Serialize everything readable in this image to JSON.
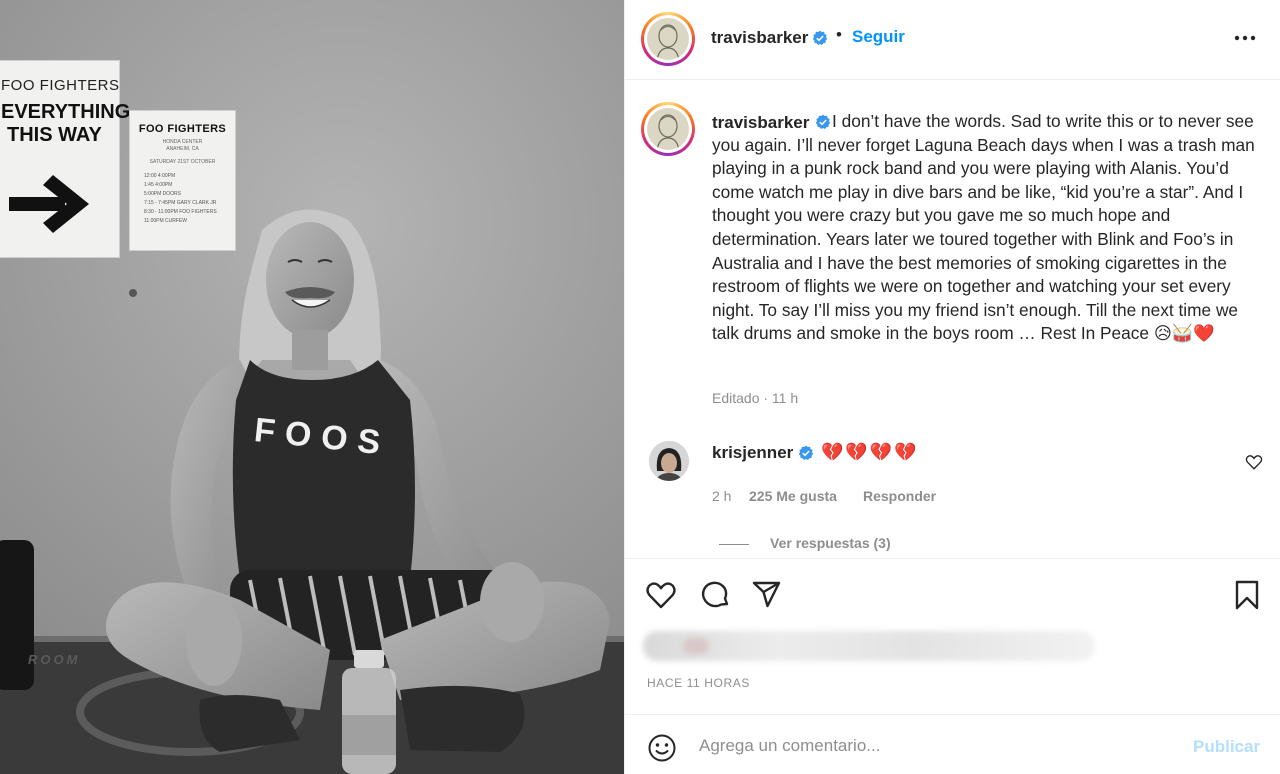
{
  "photo": {
    "sign_left": {
      "line1": "FOO FIGHTERS",
      "line2": "EVERYTHING",
      "line3": "THIS WAY"
    },
    "sign_right": {
      "title": "FOO FIGHTERS",
      "sub1": "HONDA CENTER",
      "sub2": "ANAHEIM, CA",
      "sub3": "SATURDAY 21ST OCTOBER",
      "rows": [
        "12:00  4:00PM",
        "1:45  4:00PM",
        "5:00PM   DOORS",
        "7:15 - 7:45PM   GARY CLARK JR",
        "8:30 - 11:00PM   FOO FIGHTERS",
        "11:00PM   CURFEW"
      ]
    },
    "shirt_text": "FOOS",
    "floor_text": "ROOM"
  },
  "header": {
    "username": "travisbarker",
    "dot": "•",
    "follow_label": "Seguir",
    "more_icon": "more-horizontal-icon"
  },
  "caption": {
    "username": "travisbarker",
    "text": "I don’t have the words. Sad to write this or to never see you again. I’ll never forget Laguna Beach days when I was a trash man playing in a punk rock band and you were playing with Alanis. You’d come watch me play in dive bars and be like, “kid you’re a star”. And I thought you were crazy but you gave me so much hope and determination. Years later we toured together with Blink and Foo’s in Australia and I have the best memories of smoking cigarettes in the restroom of flights we were on together and watching your set every night. To say I’ll miss you my friend isn’t enough. Till the next time we talk drums and smoke in the boys room … Rest In Peace 😥🥁❤️",
    "meta": "Editado · 11 h"
  },
  "comment": {
    "username": "krisjenner",
    "text": "💔💔💔💔",
    "time": "2 h",
    "likes": "225 Me gusta",
    "reply_label": "Responder",
    "view_replies": "Ver respuestas (3)"
  },
  "actions": {
    "icons": [
      "heart-icon",
      "comment-icon",
      "share-icon",
      "bookmark-icon"
    ],
    "time_ago": "HACE 11 HORAS"
  },
  "add_comment": {
    "placeholder": "Agrega un comentario...",
    "post_label": "Publicar"
  },
  "colors": {
    "link_blue": "#0095f6",
    "post_disabled": "#b2dffc",
    "verified_blue": "#3897f0",
    "muted_text": "#8e8e8e",
    "heart_red": "#c0182a"
  }
}
